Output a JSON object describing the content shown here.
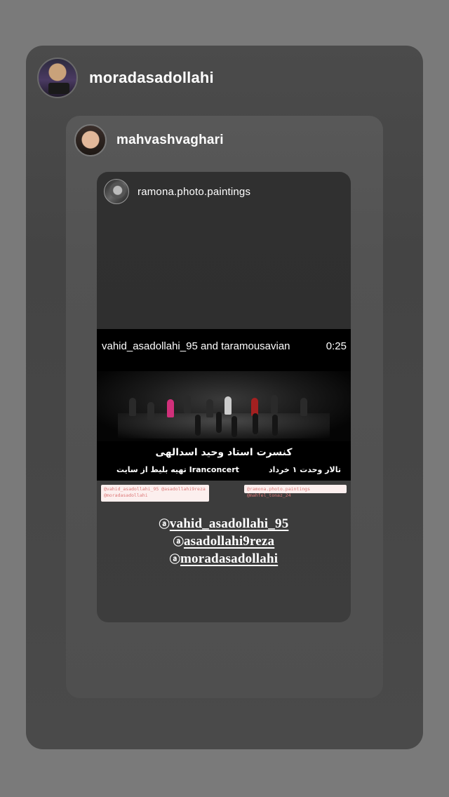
{
  "story": {
    "username": "moradasadollahi",
    "repost": {
      "username": "mahvashvaghari",
      "repost": {
        "username": "ramona.photo.paintings",
        "video": {
          "title": "vahid_asadollahi_95 and taramousavian",
          "duration": "0:25",
          "caption_main": "کنسرت استاد وحید اسدالهی",
          "caption_venue": "تالار وحدت ۱ خرداد",
          "caption_tickets": "تهیه بلیط از سایت Iranconcert"
        },
        "stickers": [
          "@vahid_asadollahi_95 @asadollahi9reza @moradasadollahi",
          "@ramona.photo.paintings @mahfel_tonaz_24"
        ],
        "mentions": [
          {
            "at": "ⓐ",
            "handle": "vahid_asadollahi_95"
          },
          {
            "at": "ⓐ",
            "handle": "asadollahi9reza"
          },
          {
            "at": "ⓐ",
            "handle": "moradasadollahi"
          }
        ]
      }
    }
  },
  "colors": {
    "background": "#7a7a7a",
    "card": "#4b4b4b",
    "video": "#000000"
  }
}
